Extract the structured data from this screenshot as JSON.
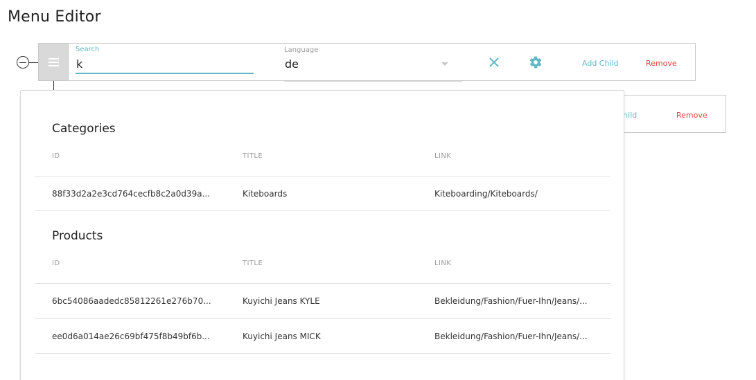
{
  "page_title": "Menu Editor",
  "menu_item": {
    "search_label": "Search",
    "search_value": "k",
    "language_label": "Language",
    "language_value": "de",
    "add_child_label": "Add Child",
    "remove_label": "Remove"
  },
  "menu_item_2": {
    "add_child_label": "d Child",
    "remove_label": "Remove"
  },
  "results": {
    "categories": {
      "title": "Categories",
      "columns": [
        "ID",
        "TITLE",
        "LINK"
      ],
      "rows": [
        {
          "id": "88f33d2a2e3cd764cecfb8c2a0d39a...",
          "title": "Kiteboards",
          "link": "Kiteboarding/Kiteboards/"
        }
      ]
    },
    "products": {
      "title": "Products",
      "columns": [
        "ID",
        "TITLE",
        "LINK"
      ],
      "rows": [
        {
          "id": "6bc54086aadedc85812261e276b70...",
          "title": "Kuyichi Jeans KYLE",
          "link": "Bekleidung/Fashion/Fuer-Ihn/Jeans/..."
        },
        {
          "id": "ee0d6a014ae26c69bf475f8b49bf6b...",
          "title": "Kuyichi Jeans MICK",
          "link": "Bekleidung/Fashion/Fuer-Ihn/Jeans/..."
        }
      ]
    }
  },
  "colors": {
    "accent": "#5fb8c6",
    "danger": "#e2443a",
    "handle": "#d9d9d9"
  }
}
